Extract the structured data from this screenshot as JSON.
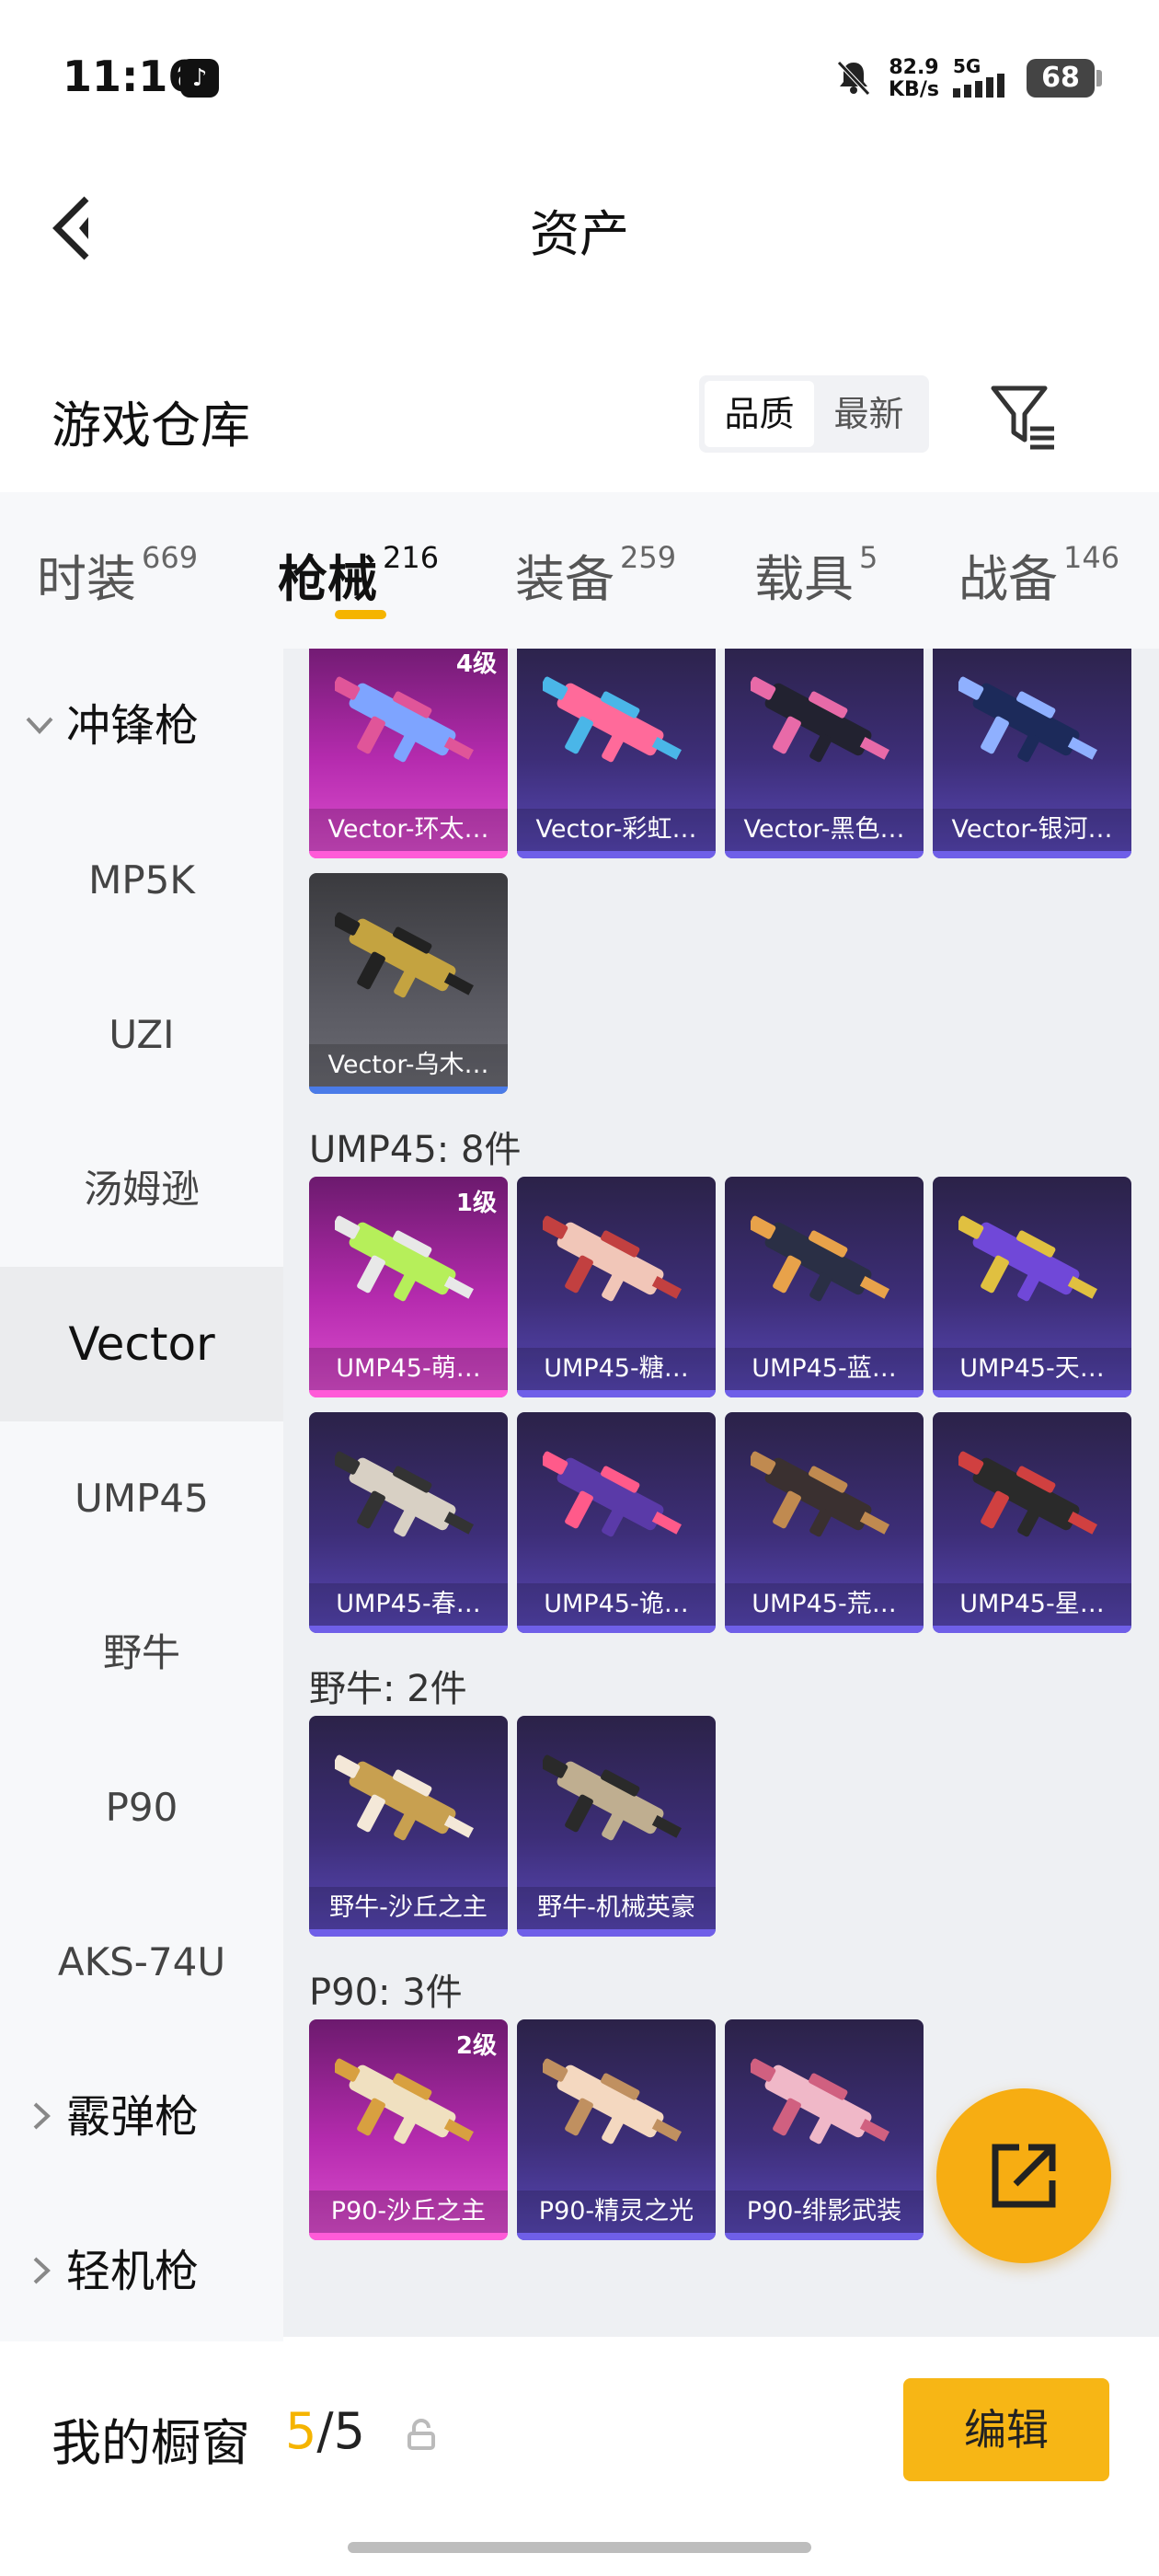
{
  "status_bar": {
    "time": "11:16",
    "net_speed_value": "82.9",
    "net_speed_unit": "KB/s",
    "signal_label": "5G",
    "battery": "68"
  },
  "header": {
    "title": "资产"
  },
  "warehouse": {
    "label": "游戏仓库",
    "sort_options": [
      "品质",
      "最新"
    ],
    "sort_selected": "品质"
  },
  "tabs": [
    {
      "label": "时装",
      "count": "669"
    },
    {
      "label": "枪械",
      "count": "216",
      "active": true
    },
    {
      "label": "装备",
      "count": "259"
    },
    {
      "label": "载具",
      "count": "5"
    },
    {
      "label": "战备",
      "count": "146"
    }
  ],
  "sidebar": [
    {
      "label": "冲锋枪",
      "type": "category",
      "expanded": true
    },
    {
      "label": "MP5K"
    },
    {
      "label": "UZI"
    },
    {
      "label": "汤姆逊"
    },
    {
      "label": "Vector",
      "active": true
    },
    {
      "label": "UMP45"
    },
    {
      "label": "野牛"
    },
    {
      "label": "P90"
    },
    {
      "label": "AKS-74U"
    },
    {
      "label": "霰弹枪",
      "type": "category",
      "expanded": false
    },
    {
      "label": "轻机枪",
      "type": "category",
      "expanded": false
    }
  ],
  "sections": [
    {
      "title": "",
      "items": [
        {
          "name": "Vector-环太…",
          "rarity": "pink",
          "level": "4级"
        },
        {
          "name": "Vector-彩虹…",
          "rarity": "purple"
        },
        {
          "name": "Vector-黑色…",
          "rarity": "purple"
        },
        {
          "name": "Vector-银河…",
          "rarity": "purple"
        },
        {
          "name": "Vector-乌木…",
          "rarity": "gray"
        }
      ]
    },
    {
      "title": "UMP45: 8件",
      "items": [
        {
          "name": "UMP45-萌…",
          "rarity": "pink",
          "level": "1级"
        },
        {
          "name": "UMP45-糖…",
          "rarity": "purple"
        },
        {
          "name": "UMP45-蓝…",
          "rarity": "purple"
        },
        {
          "name": "UMP45-天…",
          "rarity": "purple"
        },
        {
          "name": "UMP45-春…",
          "rarity": "purple"
        },
        {
          "name": "UMP45-诡…",
          "rarity": "purple"
        },
        {
          "name": "UMP45-荒…",
          "rarity": "purple"
        },
        {
          "name": "UMP45-星…",
          "rarity": "purple"
        }
      ]
    },
    {
      "title": "野牛: 2件",
      "items": [
        {
          "name": "野牛-沙丘之主",
          "rarity": "purple"
        },
        {
          "name": "野牛-机械英豪",
          "rarity": "purple"
        }
      ]
    },
    {
      "title": "P90: 3件",
      "items": [
        {
          "name": "P90-沙丘之主",
          "rarity": "pink",
          "level": "2级"
        },
        {
          "name": "P90-精灵之光",
          "rarity": "purple"
        },
        {
          "name": "P90-绯影武装",
          "rarity": "purple"
        }
      ]
    }
  ],
  "showcase": {
    "label": "我的橱窗",
    "current": "5",
    "total": "5",
    "edit_label": "编辑"
  },
  "colors": {
    "accent": "#f5b400",
    "rarity_pink": "#de4fd0",
    "rarity_purple": "#5948b8",
    "rarity_gray": "#5a5a62"
  }
}
